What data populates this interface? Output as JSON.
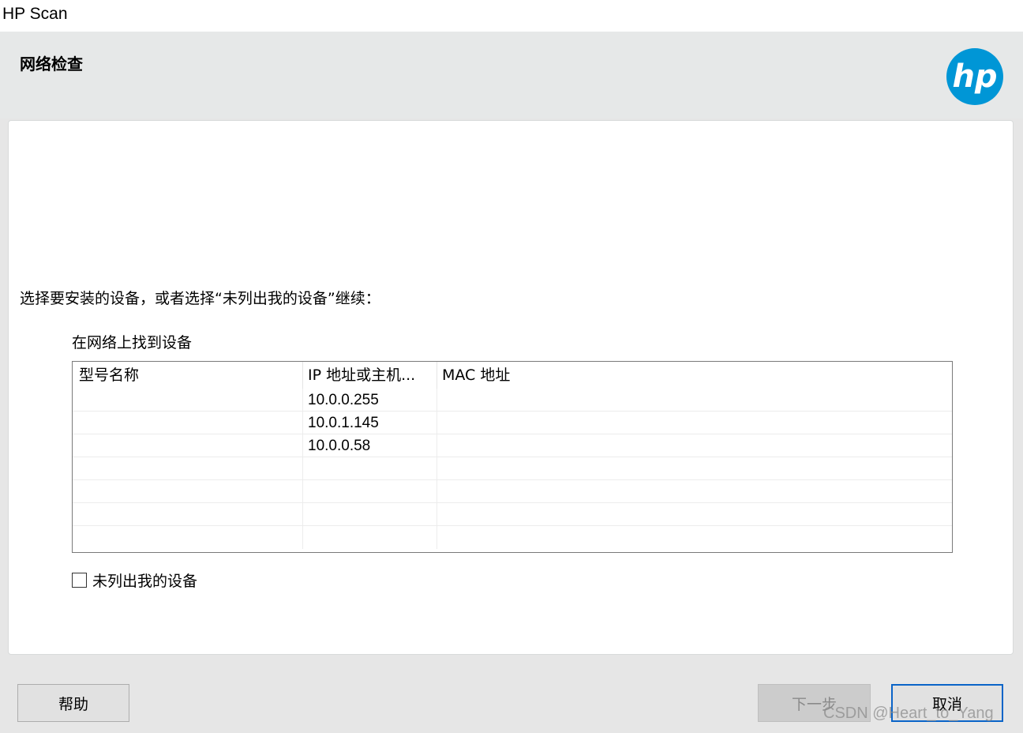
{
  "window": {
    "title": "HP Scan"
  },
  "header": {
    "page_title": "网络检查",
    "logo_text": "hp",
    "brand_color": "#0096d6"
  },
  "main": {
    "instruction": "选择要安装的设备，或者选择“未列出我的设备”继续：",
    "group_label": "在网络上找到设备",
    "table": {
      "columns": [
        "型号名称",
        "IP 地址或主机...",
        "MAC 地址"
      ],
      "rows": [
        {
          "model": "",
          "ip": "10.0.0.255",
          "mac": ""
        },
        {
          "model": "",
          "ip": "10.0.1.145",
          "mac": ""
        },
        {
          "model": "",
          "ip": "10.0.0.58",
          "mac": ""
        },
        {
          "model": "",
          "ip": "",
          "mac": ""
        },
        {
          "model": "",
          "ip": "",
          "mac": ""
        },
        {
          "model": "",
          "ip": "",
          "mac": ""
        },
        {
          "model": "",
          "ip": "",
          "mac": ""
        }
      ]
    },
    "checkbox": {
      "label": "未列出我的设备",
      "checked": false
    }
  },
  "footer": {
    "help_label": "帮助",
    "next_label": "下一步",
    "cancel_label": "取消"
  },
  "watermark": "CSDN @Heart_to_Yang"
}
